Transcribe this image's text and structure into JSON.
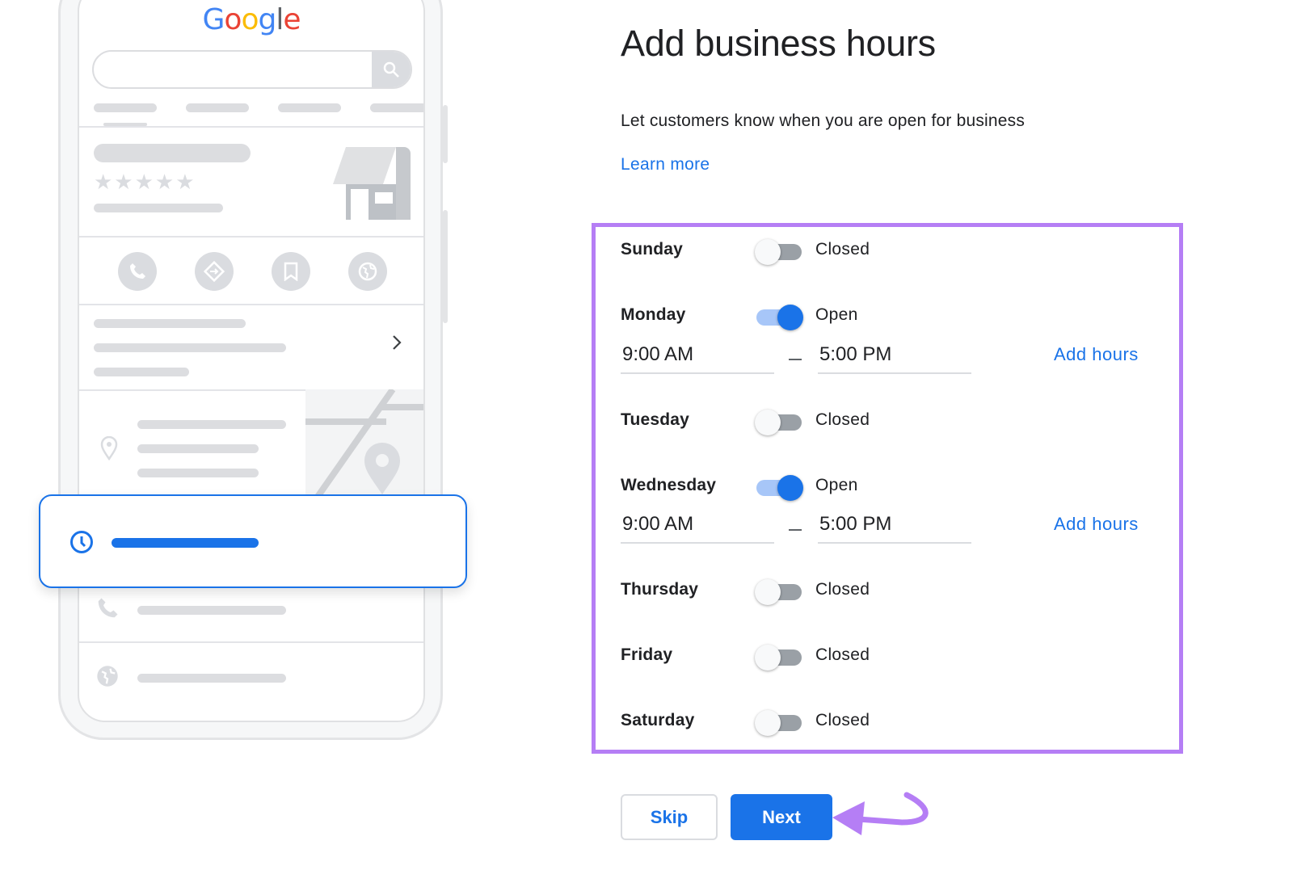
{
  "illustration": {
    "logo_text": "Google",
    "logo_letters": [
      {
        "char": "G",
        "color": "#4285f4"
      },
      {
        "char": "o",
        "color": "#ea4335"
      },
      {
        "char": "o",
        "color": "#fbbc05"
      },
      {
        "char": "g",
        "color": "#4285f4"
      },
      {
        "char": "l",
        "color": "#5f6368"
      },
      {
        "char": "e",
        "color": "#ea4335"
      }
    ],
    "action_icons": [
      "phone-icon",
      "directions-icon",
      "bookmark-icon",
      "globe-icon"
    ],
    "highlight_color": "#1a73e8"
  },
  "header": {
    "title": "Add business hours",
    "subtitle": "Let customers know when you are open for business",
    "learn_more": "Learn more"
  },
  "hours": [
    {
      "day": "Sunday",
      "open": false,
      "status": "Closed"
    },
    {
      "day": "Monday",
      "open": true,
      "status": "Open",
      "from": "9:00 AM",
      "to": "5:00 PM",
      "add_label": "Add hours"
    },
    {
      "day": "Tuesday",
      "open": false,
      "status": "Closed"
    },
    {
      "day": "Wednesday",
      "open": true,
      "status": "Open",
      "from": "9:00 AM",
      "to": "5:00 PM",
      "add_label": "Add hours"
    },
    {
      "day": "Thursday",
      "open": false,
      "status": "Closed"
    },
    {
      "day": "Friday",
      "open": false,
      "status": "Closed"
    },
    {
      "day": "Saturday",
      "open": false,
      "status": "Closed"
    }
  ],
  "actions": {
    "skip": "Skip",
    "next": "Next"
  },
  "colors": {
    "accent": "#1a73e8",
    "annotation": "#b57ef5"
  }
}
